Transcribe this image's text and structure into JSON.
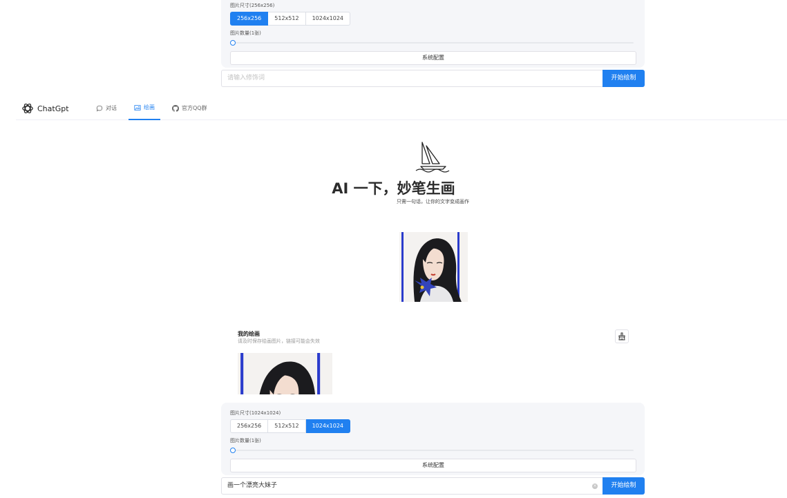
{
  "header": {
    "app_name": "ChatGpt",
    "nav": [
      {
        "label": "对话",
        "icon": "chat-bubble-icon",
        "active": false
      },
      {
        "label": "绘画",
        "icon": "image-icon",
        "active": true
      },
      {
        "label": "官方QQ群",
        "icon": "github-icon",
        "active": false
      }
    ]
  },
  "hero": {
    "title": "AI 一下，妙笔生画",
    "subtitle": "只需一句话，让你的文字变成画作"
  },
  "my_drawings": {
    "title": "我的绘画",
    "hint": "请及时保存绘画图片，链接可能会失效"
  },
  "top_panel": {
    "size_label": "图片尺寸(256x256)",
    "size_options": [
      "256x256",
      "512x512",
      "1024x1024"
    ],
    "selected_size": "256x256",
    "count_label": "图片数量(1张)",
    "count_value": 1,
    "system_config": "系统配置",
    "prompt_placeholder": "请输入修饰词",
    "prompt_value": "",
    "submit": "开始绘制"
  },
  "bottom_panel": {
    "size_label": "图片尺寸(1024x1024)",
    "size_options": [
      "256x256",
      "512x512",
      "1024x1024"
    ],
    "selected_size": "1024x1024",
    "count_label": "图片数量(1张)",
    "count_value": 1,
    "system_config": "系统配置",
    "prompt_placeholder": "请输入修饰词",
    "prompt_value": "画一个漂亮大妹子",
    "submit": "开始绘制"
  },
  "colors": {
    "accent": "#2080f0",
    "panel_bg": "#f5f6f9",
    "frame_blue": "#2a3bcc"
  }
}
